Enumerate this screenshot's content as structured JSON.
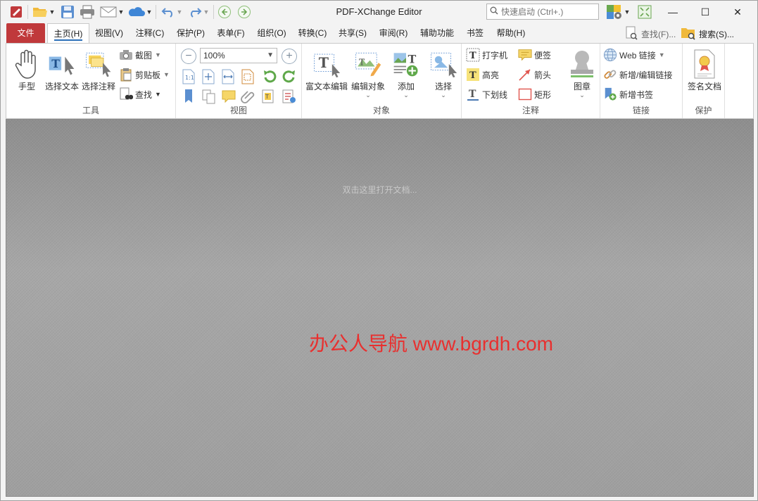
{
  "window": {
    "title": "PDF-XChange Editor",
    "minimize": "—",
    "maximize": "☐",
    "close": "✕"
  },
  "quick_launch": {
    "placeholder": "快速启动 (Ctrl+.)"
  },
  "menu": {
    "tabs": [
      {
        "label": "文件"
      },
      {
        "label": "主页(H)"
      },
      {
        "label": "视图(V)"
      },
      {
        "label": "注释(C)"
      },
      {
        "label": "保护(P)"
      },
      {
        "label": "表单(F)"
      },
      {
        "label": "组织(O)"
      },
      {
        "label": "转换(C)"
      },
      {
        "label": "共享(S)"
      },
      {
        "label": "审阅(R)"
      },
      {
        "label": "辅助功能"
      },
      {
        "label": "书签"
      },
      {
        "label": "帮助(H)"
      }
    ],
    "find": "查找(F)...",
    "search": "搜索(S)..."
  },
  "ribbon": {
    "tools": {
      "label": "工具",
      "hand": "手型",
      "select_text": "选择文本",
      "select_annot": "选择注释",
      "snapshot": "截图",
      "clipboard": "剪贴板",
      "find": "查找"
    },
    "view": {
      "label": "视图",
      "zoom": "100%"
    },
    "objects": {
      "label": "对象",
      "rich_text": "富文本编辑",
      "edit_object": "编辑对象",
      "add": "添加",
      "select": "选择"
    },
    "comments": {
      "label": "注释",
      "typewriter": "打字机",
      "note": "便签",
      "highlight": "高亮",
      "arrow": "箭头",
      "underline": "下划线",
      "rect": "矩形",
      "stamp": "图章"
    },
    "links": {
      "label": "链接",
      "web_link": "Web 链接",
      "edit_link": "新增/编辑链接",
      "add_bookmark": "新增书签"
    },
    "protect": {
      "label": "保护",
      "sign": "签名文档"
    }
  },
  "canvas": {
    "hint": "双击这里打开文档...",
    "watermark": "办公人导航  www.bgrdh.com"
  },
  "colors": {
    "file_tab": "#c0393b",
    "accent": "#2b6fb8",
    "watermark": "#e8302f"
  }
}
